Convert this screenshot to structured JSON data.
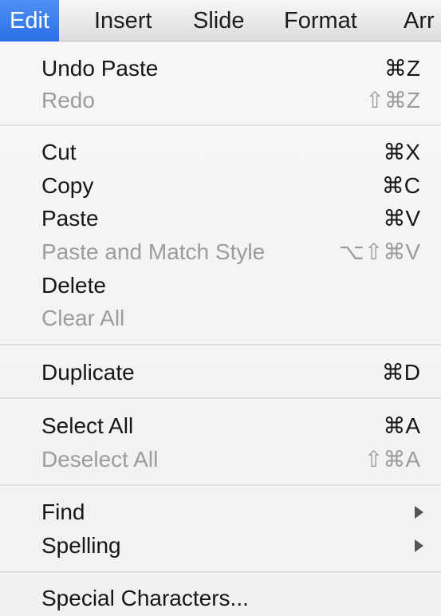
{
  "menubar": {
    "items": [
      "Edit",
      "Insert",
      "Slide",
      "Format",
      "Arr"
    ],
    "active": "Edit"
  },
  "menu": {
    "group1": {
      "undo": {
        "label": "Undo Paste",
        "shortcut": "⌘Z",
        "enabled": true
      },
      "redo": {
        "label": "Redo",
        "shortcut": "⇧⌘Z",
        "enabled": false
      }
    },
    "group2": {
      "cut": {
        "label": "Cut",
        "shortcut": "⌘X",
        "enabled": true
      },
      "copy": {
        "label": "Copy",
        "shortcut": "⌘C",
        "enabled": true
      },
      "paste": {
        "label": "Paste",
        "shortcut": "⌘V",
        "enabled": true
      },
      "paste_match": {
        "label": "Paste and Match Style",
        "shortcut": "⌥⇧⌘V",
        "enabled": false
      },
      "delete": {
        "label": "Delete",
        "shortcut": "",
        "enabled": true
      },
      "clear_all": {
        "label": "Clear All",
        "shortcut": "",
        "enabled": false
      }
    },
    "group3": {
      "duplicate": {
        "label": "Duplicate",
        "shortcut": "⌘D",
        "enabled": true
      }
    },
    "group4": {
      "select_all": {
        "label": "Select All",
        "shortcut": "⌘A",
        "enabled": true
      },
      "deselect_all": {
        "label": "Deselect All",
        "shortcut": "⇧⌘A",
        "enabled": false
      }
    },
    "group5": {
      "find": {
        "label": "Find",
        "submenu_icon": "chevron-right-icon",
        "enabled": true
      },
      "spelling": {
        "label": "Spelling",
        "submenu_icon": "chevron-right-icon",
        "enabled": true
      }
    },
    "group6": {
      "special_chars": {
        "label": "Special Characters...",
        "enabled": true
      }
    }
  }
}
